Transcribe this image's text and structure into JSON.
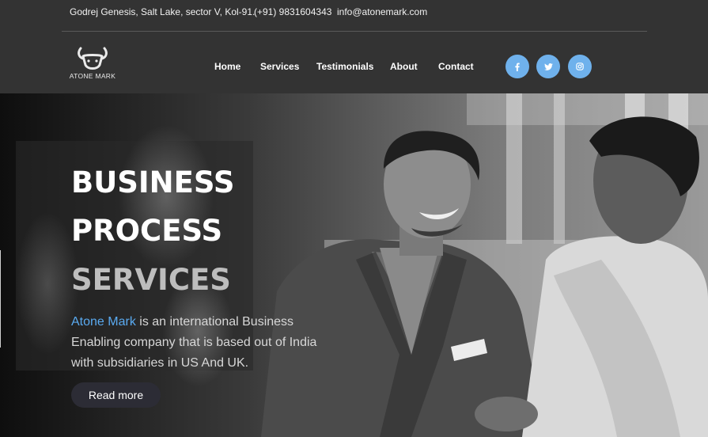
{
  "topbar": {
    "address": "Godrej Genesis, Salt Lake, sector V, Kol-91.",
    "phone": "(+91) 9831604343",
    "email": "info@atonemark.com"
  },
  "logo": {
    "text": "ATONE MARK",
    "icon": "bull-head-icon"
  },
  "nav": {
    "items": [
      {
        "label": "Home"
      },
      {
        "label": "Services"
      },
      {
        "label": "Testimonials"
      },
      {
        "label": "About"
      },
      {
        "label": "Contact"
      }
    ]
  },
  "social": {
    "color": "#6fb1ec",
    "items": [
      {
        "icon": "facebook-icon",
        "glyph": "f"
      },
      {
        "icon": "twitter-icon",
        "glyph": "t"
      },
      {
        "icon": "instagram-icon",
        "glyph": "ig"
      }
    ]
  },
  "hero": {
    "line1": "BUSINESS",
    "line2": "PROCESS",
    "line3": "SERVICES",
    "brand": "Atone Mark",
    "description": " is an international Business Enabling company that is based out of India with subsidiaries in US And UK.",
    "button": "Read more",
    "brand_color": "#5aaaf0"
  }
}
